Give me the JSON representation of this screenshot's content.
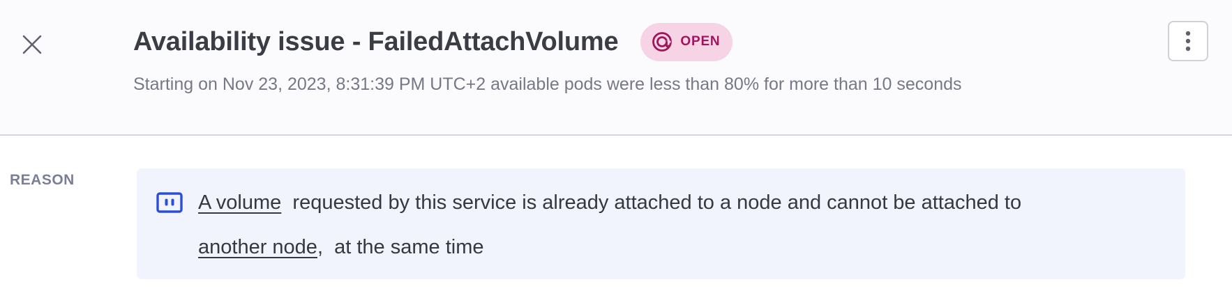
{
  "header": {
    "title": "Availability issue - FailedAttachVolume",
    "status": "OPEN",
    "subtitle": "Starting on Nov 23, 2023, 8:31:39 PM UTC+2 available pods were less than 80% for more than 10 seconds"
  },
  "reason": {
    "label": "REASON",
    "link1": "A volume",
    "text1": "requested by this service is already attached to a node and cannot be attached to",
    "link2": "another node",
    "text2": "at the same time"
  },
  "icons": {
    "close": "close-icon",
    "status": "open-status-icon",
    "more": "more-vertical-icon",
    "reason": "volume-icon"
  },
  "colors": {
    "status_bg": "#f6d4e6",
    "status_text": "#a0155c",
    "reason_bg": "#f1f4fd",
    "reason_icon": "#2a4fd6"
  }
}
